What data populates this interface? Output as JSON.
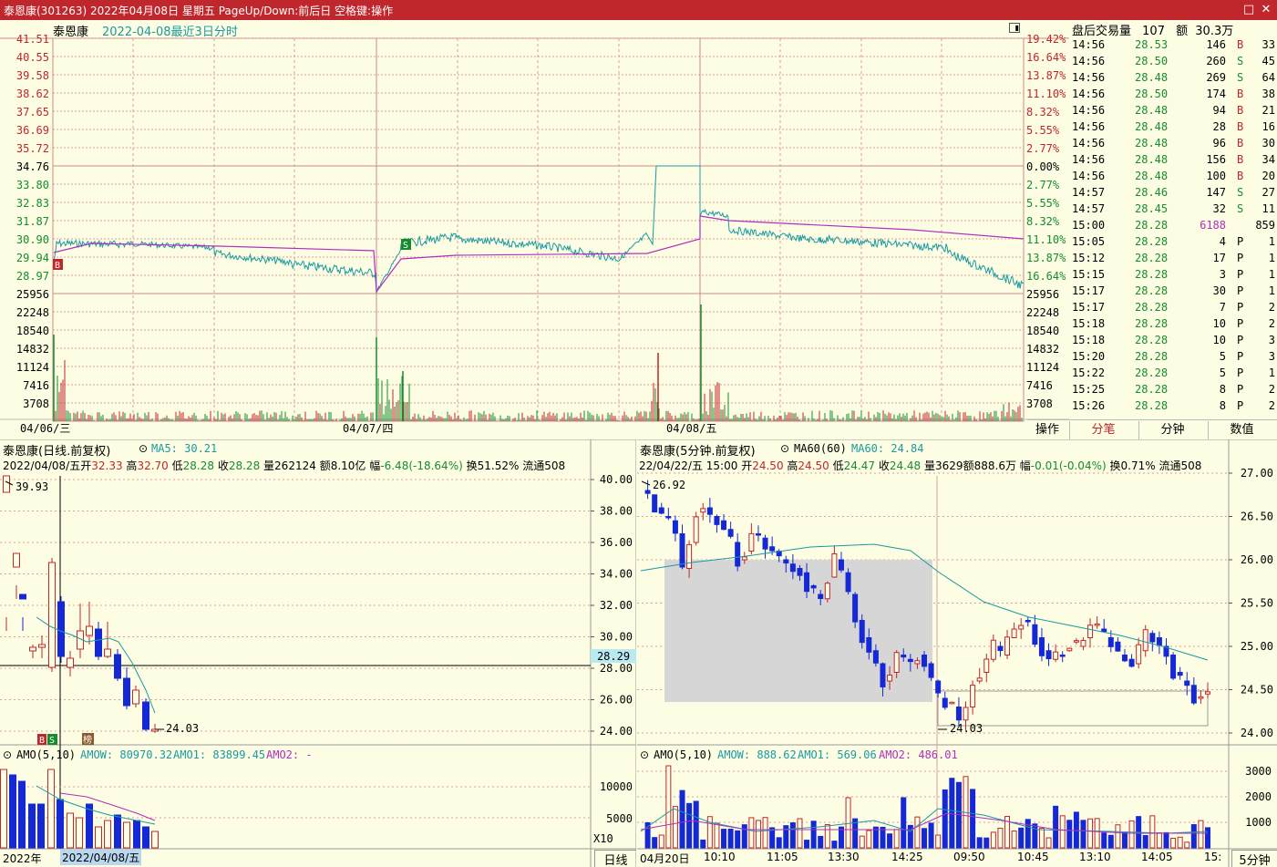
{
  "window": {
    "title": "泰恩康(301263) 2022年04月08日 星期五 PageUp/Down:前后日 空格键:操作",
    "restore_icon": "restore-icon",
    "close_icon": "close-icon"
  },
  "intraday": {
    "stock_name": "泰恩康",
    "subtitle": "2022-04-08最近3日分时",
    "price_axis_left": [
      "41.51",
      "40.55",
      "39.58",
      "38.62",
      "37.65",
      "36.69",
      "35.72",
      "34.76",
      "33.80",
      "32.83",
      "31.87",
      "30.90",
      "29.94",
      "28.97"
    ],
    "price_axis_right": [
      "19.42%",
      "16.64%",
      "13.87%",
      "11.10%",
      "8.32%",
      "5.55%",
      "2.77%",
      "0.00%",
      "2.77%",
      "5.55%",
      "8.32%",
      "11.10%",
      "13.87%",
      "16.64%"
    ],
    "volume_axis": [
      "25956",
      "22248",
      "18540",
      "14832",
      "11124",
      "7416",
      "3708"
    ],
    "date_labels": [
      "04/06/三",
      "04/07/四",
      "04/08/五"
    ],
    "buy_marker": "B",
    "sell_marker": "S",
    "colors": {
      "price_line": "#1a9aa0",
      "avg_line": "#b12fbe",
      "grid": "#d9a0a0",
      "up": "#c0272d",
      "down": "#158c2e"
    }
  },
  "trades": {
    "header": "盘后交易量",
    "count": "107",
    "amount_label": "额",
    "amount": "30.3万",
    "rows": [
      {
        "time": "14:56",
        "price": "28.53",
        "vol": "146",
        "bs": "B",
        "n": "33"
      },
      {
        "time": "14:56",
        "price": "28.50",
        "vol": "260",
        "bs": "S",
        "n": "45"
      },
      {
        "time": "14:56",
        "price": "28.48",
        "vol": "269",
        "bs": "S",
        "n": "64"
      },
      {
        "time": "14:56",
        "price": "28.50",
        "vol": "174",
        "bs": "B",
        "n": "38"
      },
      {
        "time": "14:56",
        "price": "28.48",
        "vol": "94",
        "bs": "B",
        "n": "21"
      },
      {
        "time": "14:56",
        "price": "28.48",
        "vol": "28",
        "bs": "B",
        "n": "16"
      },
      {
        "time": "14:56",
        "price": "28.48",
        "vol": "96",
        "bs": "B",
        "n": "30"
      },
      {
        "time": "14:56",
        "price": "28.48",
        "vol": "156",
        "bs": "B",
        "n": "34"
      },
      {
        "time": "14:56",
        "price": "28.48",
        "vol": "100",
        "bs": "B",
        "n": "20"
      },
      {
        "time": "14:57",
        "price": "28.46",
        "vol": "147",
        "bs": "S",
        "n": "27"
      },
      {
        "time": "14:57",
        "price": "28.45",
        "vol": "32",
        "bs": "S",
        "n": "11"
      },
      {
        "time": "15:00",
        "price": "28.28",
        "vol": "6188",
        "bs": "",
        "n": "859"
      },
      {
        "time": "15:05",
        "price": "28.28",
        "vol": "4",
        "bs": "P",
        "n": "1"
      },
      {
        "time": "15:12",
        "price": "28.28",
        "vol": "17",
        "bs": "P",
        "n": "1"
      },
      {
        "time": "15:15",
        "price": "28.28",
        "vol": "3",
        "bs": "P",
        "n": "1"
      },
      {
        "time": "15:17",
        "price": "28.28",
        "vol": "30",
        "bs": "P",
        "n": "1"
      },
      {
        "time": "15:17",
        "price": "28.28",
        "vol": "7",
        "bs": "P",
        "n": "2"
      },
      {
        "time": "15:18",
        "price": "28.28",
        "vol": "10",
        "bs": "P",
        "n": "2"
      },
      {
        "time": "15:18",
        "price": "28.28",
        "vol": "10",
        "bs": "P",
        "n": "3"
      },
      {
        "time": "15:20",
        "price": "28.28",
        "vol": "5",
        "bs": "P",
        "n": "3"
      },
      {
        "time": "15:22",
        "price": "28.28",
        "vol": "5",
        "bs": "P",
        "n": "1"
      },
      {
        "time": "15:25",
        "price": "28.28",
        "vol": "8",
        "bs": "P",
        "n": "2"
      },
      {
        "time": "15:26",
        "price": "28.28",
        "vol": "8",
        "bs": "P",
        "n": "2"
      }
    ]
  },
  "tabs": [
    "操作",
    "分笔",
    "分钟",
    "数值"
  ],
  "daily": {
    "title": "泰恩康(日线.前复权)",
    "ma_label": "MA5: 30.21",
    "info_date": "2022/04/08/五",
    "open_label": "开",
    "open": "32.33",
    "high_label": "高",
    "high": "32.70",
    "low_label": "低",
    "low": "28.28",
    "close_label": "收",
    "close": "28.28",
    "vol_label": "量",
    "vol": "262124",
    "amt_label": "额",
    "amt": "8.10亿",
    "chg_label": "幅",
    "chg": "-6.48(-18.64%)",
    "turn_label": "换",
    "turn": "51.52%",
    "float_label": "流通508",
    "axis": [
      "40.00",
      "38.00",
      "36.00",
      "34.00",
      "32.00",
      "30.00",
      "28.00",
      "26.00",
      "24.00"
    ],
    "cursor_price": "28.29",
    "high_mark": "39.93",
    "low_mark": "24.03",
    "marker_b": "B",
    "marker_s": "S",
    "marker_bang": "榜",
    "amo_title": "AMO(5,10)",
    "amow_label": "AMOW: 80970.32",
    "amo1_label": "AMO1: 83899.45",
    "amo2_label": "AMO2: -",
    "amo_axis": [
      "10000",
      "5000"
    ],
    "amo_unit": "X10",
    "x_labels": [
      "2022年",
      "2022/04/08/五"
    ],
    "period_button": "日线"
  },
  "min5": {
    "title": "泰恩康(5分钟.前复权)",
    "ma_label": "MA60(60)",
    "ma_value": "MA60: 24.84",
    "info_date": "22/04/22/五",
    "info_time": "15:00",
    "open_label": "开",
    "open": "24.50",
    "high_label": "高",
    "high": "24.50",
    "low_label": "低",
    "low": "24.47",
    "close_label": "收",
    "close": "24.48",
    "vol_label": "量",
    "vol": "3629",
    "amt_label": "额",
    "amt": "888.6万",
    "chg_label": "幅",
    "chg": "-0.01(-0.04%)",
    "turn_label": "换",
    "turn": "0.71%",
    "float_label": "流通508",
    "axis": [
      "27.00",
      "26.50",
      "26.00",
      "25.50",
      "25.00",
      "24.50",
      "24.00"
    ],
    "high_mark": "26.92",
    "low_mark": "24.03",
    "amo_title": "AMO(5,10)",
    "amow_label": "AMOW: 888.62",
    "amo1_label": "AMO1: 569.06",
    "amo2_label": "AMO2: 486.01",
    "amo_axis": [
      "3000",
      "2000",
      "1000"
    ],
    "x_labels": [
      "04月20日",
      "10:10",
      "11:05",
      "13:30",
      "14:25",
      "09:50",
      "10:45",
      "13:10",
      "14:05",
      "15:"
    ],
    "period_button": "5分钟"
  }
}
